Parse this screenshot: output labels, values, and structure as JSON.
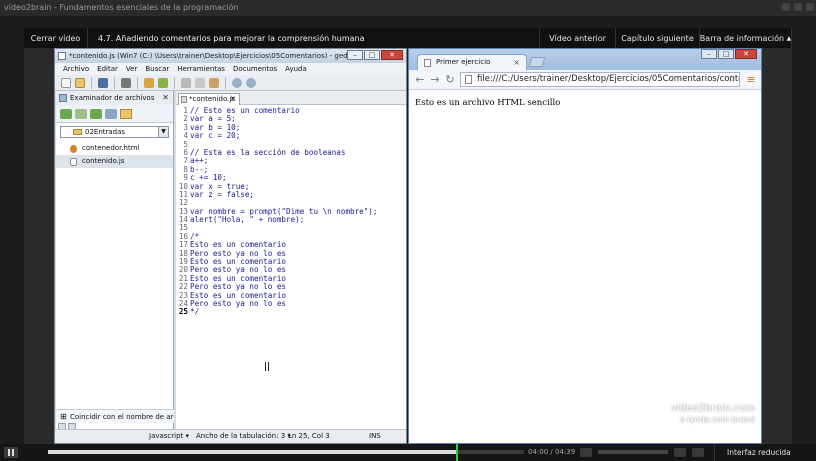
{
  "app_title": "video2brain - Fundamentos esenciales de la programación",
  "topbar": {
    "close_label": "Cerrar vídeo",
    "lesson_title": "4.7. Añadiendo comentarios para mejorar la comprensión humana",
    "prev_label": "Vídeo anterior",
    "next_label": "Capítulo siguiente",
    "info_label": "Barra de información",
    "info_arrow": "▲"
  },
  "gedit": {
    "title": "*contenido.js (Win7 (C:) \\Users\\trainer\\Desktop\\Ejercicios\\05Comentarios) - gedit",
    "menu": [
      "Archivo",
      "Editar",
      "Ver",
      "Buscar",
      "Herramientas",
      "Documentos",
      "Ayuda"
    ],
    "side_panel_title": "Examinador de archivos",
    "folder": "02Entradas",
    "files": [
      "contenedor.html",
      "contenido.js"
    ],
    "filter_label": "Coincidir con el nombre de archivo",
    "tab_label": "*contenido.js",
    "code_lines": [
      {
        "n": "1",
        "t": "// Esto es un comentario"
      },
      {
        "n": "2",
        "t": "var a = 5;"
      },
      {
        "n": "3",
        "t": "var b = 10;"
      },
      {
        "n": "4",
        "t": "var c = 20;"
      },
      {
        "n": "5",
        "t": ""
      },
      {
        "n": "6",
        "t": "// Esta es la sección de booleanas"
      },
      {
        "n": "7",
        "t": "a++;"
      },
      {
        "n": "8",
        "t": "b--;"
      },
      {
        "n": "9",
        "t": "c += 10;"
      },
      {
        "n": "10",
        "t": "var x = true;"
      },
      {
        "n": "11",
        "t": "var z = false;"
      },
      {
        "n": "12",
        "t": ""
      },
      {
        "n": "13",
        "t": "var nombre = prompt(\"Dime tu \\n nombre\");"
      },
      {
        "n": "14",
        "t": "alert(\"Hola, \" + nombre);"
      },
      {
        "n": "15",
        "t": ""
      },
      {
        "n": "16",
        "t": "/*"
      },
      {
        "n": "17",
        "t": "Esto es un comentario"
      },
      {
        "n": "18",
        "t": "Pero esto ya no lo es"
      },
      {
        "n": "19",
        "t": "Esto es un comentario"
      },
      {
        "n": "20",
        "t": "Pero esto ya no lo es"
      },
      {
        "n": "21",
        "t": "Esto es un comentario"
      },
      {
        "n": "22",
        "t": "Pero esto ya no lo es"
      },
      {
        "n": "23",
        "t": "Esto es un comentario"
      },
      {
        "n": "24",
        "t": "Pero esto ya no lo es"
      },
      {
        "n": "25",
        "t": "*/"
      }
    ],
    "status": {
      "language": "Javascript",
      "tab_width": "Ancho de la tabulación: 3",
      "position": "Ln 25, Col 3",
      "mode": "INS"
    }
  },
  "chrome": {
    "tab_title": "Primer ejercicio",
    "url": "file:///C:/Users/trainer/Desktop/Ejercicios/05Comentarios/contenedor.html",
    "page_text": "Esto es un archivo HTML sencillo"
  },
  "watermark": {
    "line1": "video2brain.com",
    "line2": "a lynda.com brand"
  },
  "player": {
    "time": "04:00 / 04:39",
    "progress": 0.86,
    "reduced_label": "Interfaz reducida"
  }
}
